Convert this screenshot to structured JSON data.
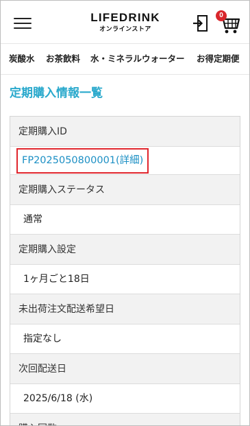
{
  "header": {
    "logo_main": "LIFEDRINK",
    "logo_sub": "オンラインストア",
    "menu_icon": "hamburger-menu-icon",
    "login_icon": "login-door-icon",
    "cart_icon": "shopping-cart-icon",
    "cart_count": "0"
  },
  "categories": [
    {
      "label": "炭酸水"
    },
    {
      "label": "お茶飲料"
    },
    {
      "label": "水・ミネラルウォーター"
    },
    {
      "label": "お得定期便"
    }
  ],
  "page": {
    "title": "定期購入情報一覧"
  },
  "subscription": {
    "id_label": "定期購入ID",
    "id_value": "FP2025050800001(詳細)",
    "status_label": "定期購入ステータス",
    "status_value": "通常",
    "setting_label": "定期購入設定",
    "setting_value": "1ヶ月ごと18日",
    "pending_label": "未出荷注文配送希望日",
    "pending_value": "指定なし",
    "next_label": "次回配送日",
    "next_value": "2025/6/18 (水)",
    "count_label": "購入回数"
  },
  "colors": {
    "accent": "#2aa9cc",
    "link": "#1b8fc4",
    "highlight_border": "#e0252c",
    "badge": "#d9262c"
  }
}
